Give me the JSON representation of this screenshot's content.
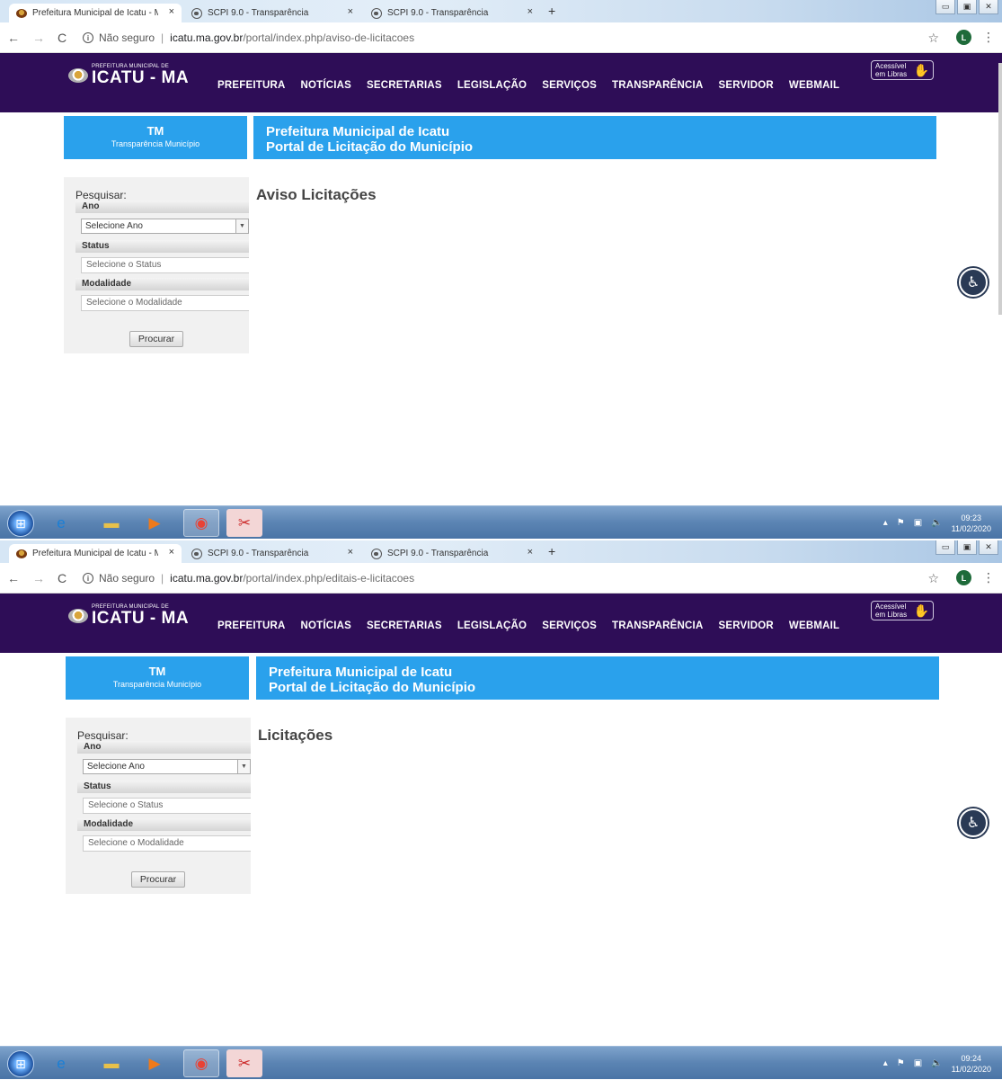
{
  "shots": [
    {
      "tabs": [
        {
          "title": "Prefeitura Municipal de Icatu - M",
          "active": true
        },
        {
          "title": "SCPI 9.0 - Transparência",
          "active": false
        },
        {
          "title": "SCPI 9.0 - Transparência",
          "active": false
        }
      ],
      "tab_close": "×",
      "new_tab": "+",
      "address": {
        "security": "Não seguro",
        "host": "icatu.ma.gov.br",
        "path": "/portal/index.php/aviso-de-licitacoes"
      },
      "profile_letter": "L",
      "heading": "Aviso Licitações",
      "clock": {
        "time": "09:23",
        "date": "11/02/2020"
      }
    },
    {
      "tabs": [
        {
          "title": "Prefeitura Municipal de Icatu - M",
          "active": true
        },
        {
          "title": "SCPI 9.0 - Transparência",
          "active": false
        },
        {
          "title": "SCPI 9.0 - Transparência",
          "active": false
        }
      ],
      "tab_close": "×",
      "new_tab": "+",
      "address": {
        "security": "Não seguro",
        "host": "icatu.ma.gov.br",
        "path": "/portal/index.php/editais-e-licitacoes"
      },
      "profile_letter": "L",
      "heading": "Licitações",
      "clock": {
        "time": "09:24",
        "date": "11/02/2020"
      }
    }
  ],
  "site": {
    "logo_small": "PREFEITURA MUNICIPAL DE",
    "logo_big": "ICATU - MA",
    "menu": [
      "PREFEITURA",
      "NOTÍCIAS",
      "SECRETARIAS",
      "LEGISLAÇÃO",
      "SERVIÇOS",
      "TRANSPARÊNCIA",
      "SERVIDOR",
      "WEBMAIL"
    ],
    "libras_line1": "Acessível",
    "libras_line2": "em Libras",
    "tm_title": "TM",
    "tm_sub": "Transparência Município",
    "portal_line1": "Prefeitura Municipal de Icatu",
    "portal_line2": "Portal de Licitação do Município"
  },
  "search": {
    "label": "Pesquisar:",
    "ano_label": "Ano",
    "ano_select": "Selecione Ano",
    "status_label": "Status",
    "status_placeholder": "Selecione o Status",
    "modalidade_label": "Modalidade",
    "modalidade_placeholder": "Selecione o Modalidade",
    "button": "Procurar"
  },
  "colors": {
    "header_bg": "#2e0d57",
    "portal_blue": "#2aa1ec"
  }
}
